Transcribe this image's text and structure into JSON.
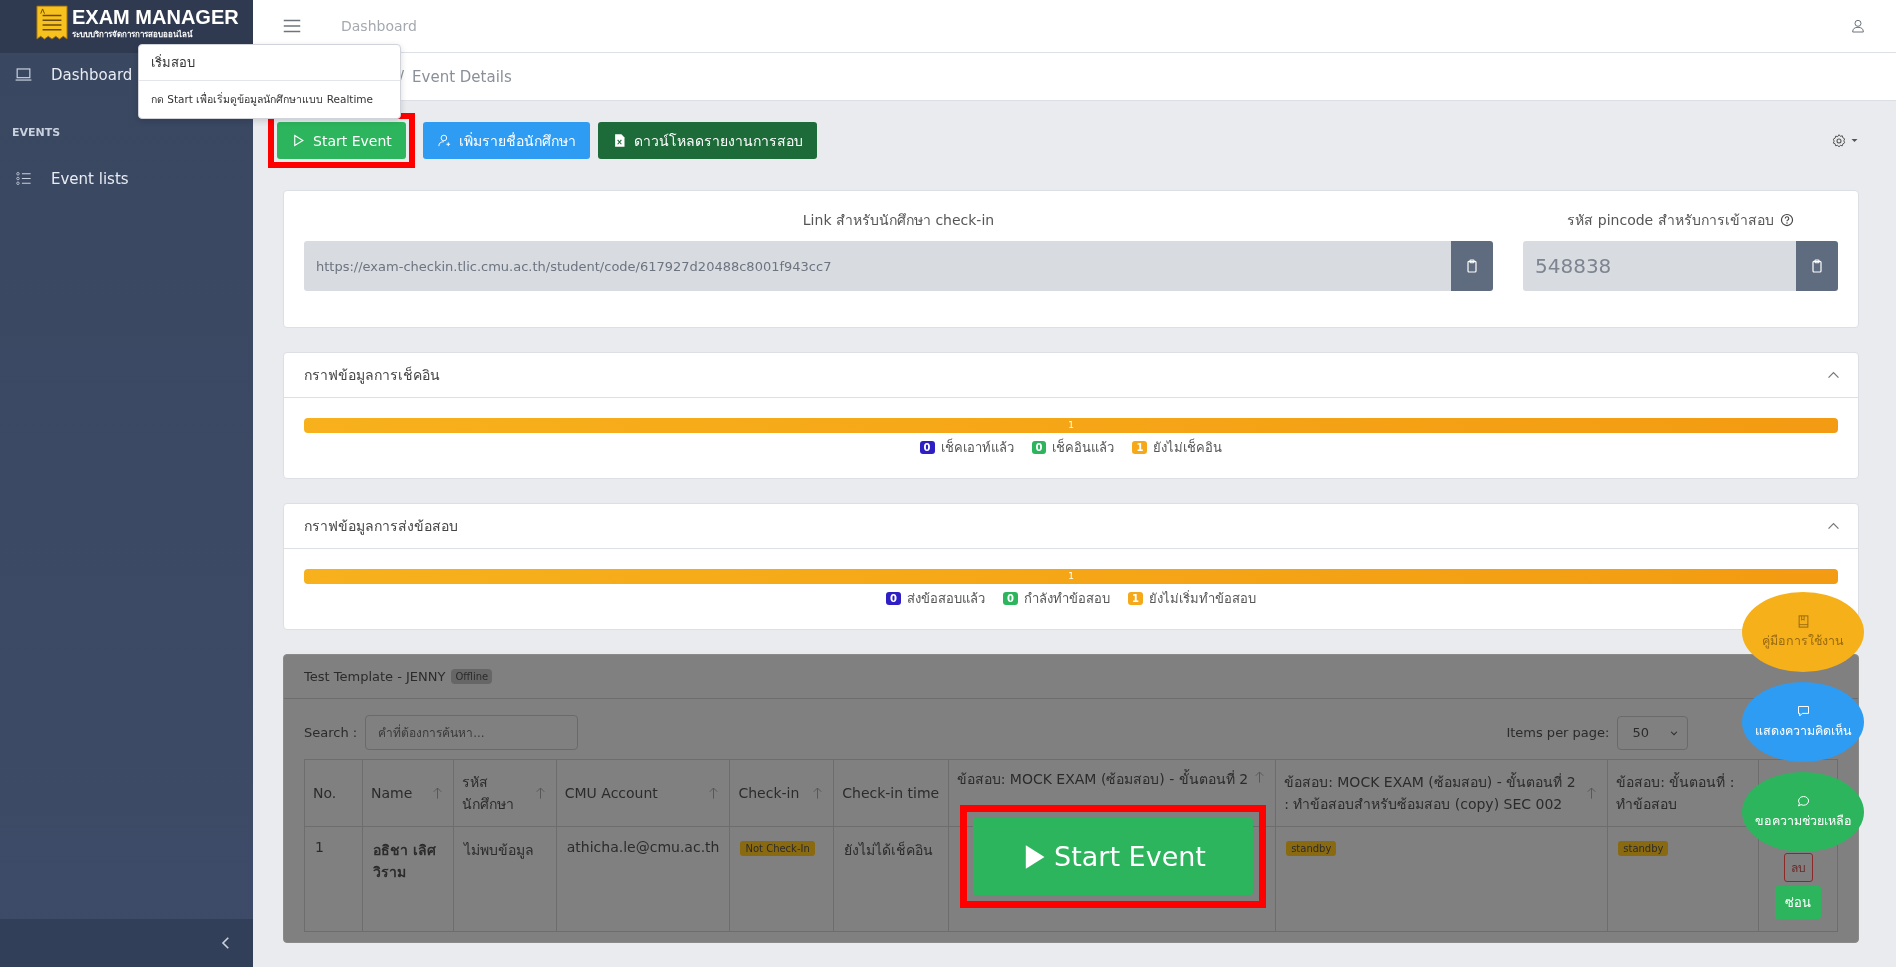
{
  "app": {
    "logo_title": "EXAM MANAGER",
    "logo_subtitle": "ระบบบริการจัดการการสอบออนไลน์"
  },
  "sidebar": {
    "items": [
      {
        "kind": "link",
        "label": "Dashboard"
      },
      {
        "kind": "section",
        "label": "EVENTS"
      },
      {
        "kind": "link",
        "label": "Event lists"
      }
    ]
  },
  "topbar": {
    "title": "Dashboard"
  },
  "breadcrumb": {
    "separator": "/",
    "current": "Event Details"
  },
  "popover": {
    "title": "เริ่มสอบ",
    "body": "กด Start เพื่อเริ่มดูข้อมูลนักศึกษาแบบ Realtime"
  },
  "actions": [
    {
      "kind": "start",
      "label": "Start Event",
      "highlighted": true
    },
    {
      "kind": "add",
      "label": "เพิ่มรายชื่อนักศึกษา",
      "highlighted": false
    },
    {
      "kind": "download",
      "label": "ดาวน์โหลดรายงานการสอบ",
      "highlighted": false
    }
  ],
  "links": [
    {
      "label": "Link สำหรับนักศึกษา check-in",
      "value": "https://exam-checkin.tlic.cmu.ac.th/student/code/617927d20488c8001f943cc7",
      "help": false,
      "wide": true
    },
    {
      "label": "รหัส pincode สำหรับการเข้าสอบ",
      "value": "548838",
      "help": true,
      "wide": false
    }
  ],
  "panels": [
    {
      "title": "กราฟข้อมูลการเช็คอิน",
      "expanded": true,
      "bar": {
        "label": "1",
        "level": 1
      },
      "legend": [
        {
          "count": "0",
          "label": "เช็คเอาท์แล้ว",
          "color": "#2d1fc4"
        },
        {
          "count": "0",
          "label": "เช็คอินแล้ว",
          "color": "#2db55d"
        },
        {
          "count": "1",
          "label": "ยังไม่เช็คอิน",
          "color": "#f5a91a"
        }
      ]
    },
    {
      "title": "กราฟข้อมูลการส่งข้อสอบ",
      "expanded": true,
      "bar": {
        "label": "1",
        "level": 1
      },
      "legend": [
        {
          "count": "0",
          "label": "ส่งข้อสอบแล้ว",
          "color": "#2d1fc4"
        },
        {
          "count": "0",
          "label": "กำลังทำข้อสอบ",
          "color": "#2db55d"
        },
        {
          "count": "1",
          "label": "ยังไม่เริ่มทำข้อสอบ",
          "color": "#f5a91a"
        }
      ]
    }
  ],
  "event": {
    "title": "Test Template - JENNY",
    "status": "Offline",
    "search": {
      "label": "Search :",
      "placeholder": "คำที่ต้องการค้นหา..."
    },
    "items_per_page": {
      "label": "Items per page:",
      "value": "50"
    },
    "columns": [
      {
        "label": "No.",
        "sortable": false
      },
      {
        "label": "Name",
        "sortable": true
      },
      {
        "label": "รหัส นักศึกษา",
        "sortable": true
      },
      {
        "label": "CMU Account",
        "sortable": true
      },
      {
        "label": "Check-in",
        "sortable": true
      },
      {
        "label": "Check-in time",
        "sortable": false
      },
      {
        "label": "ข้อสอบ: MOCK EXAM (ซ้อมสอบ) - ขั้นตอนที่ 2",
        "sortable": true
      },
      {
        "label": "ข้อสอบ: MOCK EXAM (ซ้อมสอบ) - ขั้นตอนที่ 2 : ทำข้อสอบสำหรับซ้อมสอบ (copy) SEC 002",
        "sortable": true
      },
      {
        "label": "ข้อสอบ: ขั้นตอนที่ : ทำข้อสอบ",
        "sortable": false
      },
      {
        "sortable": false
      }
    ],
    "rows": [
      {
        "cells": [
          {
            "kind": "text",
            "text": "1"
          },
          {
            "kind": "bold",
            "text": "อธิชา เลิศวิราม"
          },
          {
            "kind": "text",
            "text": "ไม่พบข้อมูล"
          },
          {
            "kind": "text",
            "text": "athicha.le@cmu.ac.th"
          },
          {
            "kind": "badge",
            "text": "Not Check-In"
          },
          {
            "kind": "text",
            "text": "ยังไม่ได้เช็คอิน"
          },
          {
            "kind": "empty"
          },
          {
            "kind": "badge",
            "text": "standby"
          },
          {
            "kind": "badge",
            "text": "standby"
          },
          {
            "kind": "actions",
            "buttons": [
              "ลบ",
              "ซ่อน"
            ]
          }
        ]
      }
    ]
  },
  "spotlight": {
    "label": "Start Event"
  },
  "help_buttons": [
    {
      "kind": "manual",
      "label": "คู่มือการใช้งาน",
      "color": "#f5b01a"
    },
    {
      "kind": "feedback",
      "label": "แสดงความคิดเห็น",
      "color": "#2e9cf2"
    },
    {
      "kind": "help",
      "label": "ขอความช่วยเหลือ",
      "color": "#2db55d"
    }
  ]
}
